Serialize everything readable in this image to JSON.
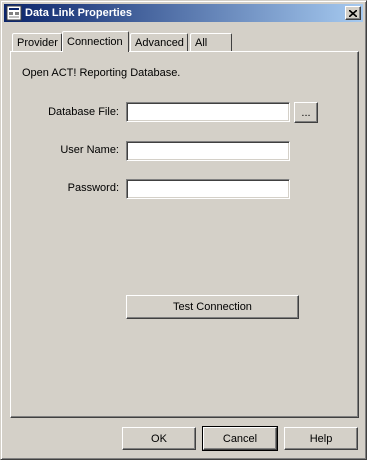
{
  "window": {
    "title": "Data Link Properties",
    "icon": "data-link-icon",
    "close_icon": "close-icon"
  },
  "tabs": [
    {
      "label": "Provider",
      "active": false
    },
    {
      "label": "Connection",
      "active": true
    },
    {
      "label": "Advanced",
      "active": false
    },
    {
      "label": "All",
      "active": false
    }
  ],
  "connection": {
    "heading": "Open ACT! Reporting Database.",
    "database_file": {
      "label": "Database File:",
      "value": ""
    },
    "browse_label": "...",
    "user_name": {
      "label": "User Name:",
      "value": ""
    },
    "password": {
      "label": "Password:",
      "value": ""
    },
    "test_connection_label": "Test Connection"
  },
  "footer": {
    "ok_label": "OK",
    "cancel_label": "Cancel",
    "help_label": "Help"
  }
}
